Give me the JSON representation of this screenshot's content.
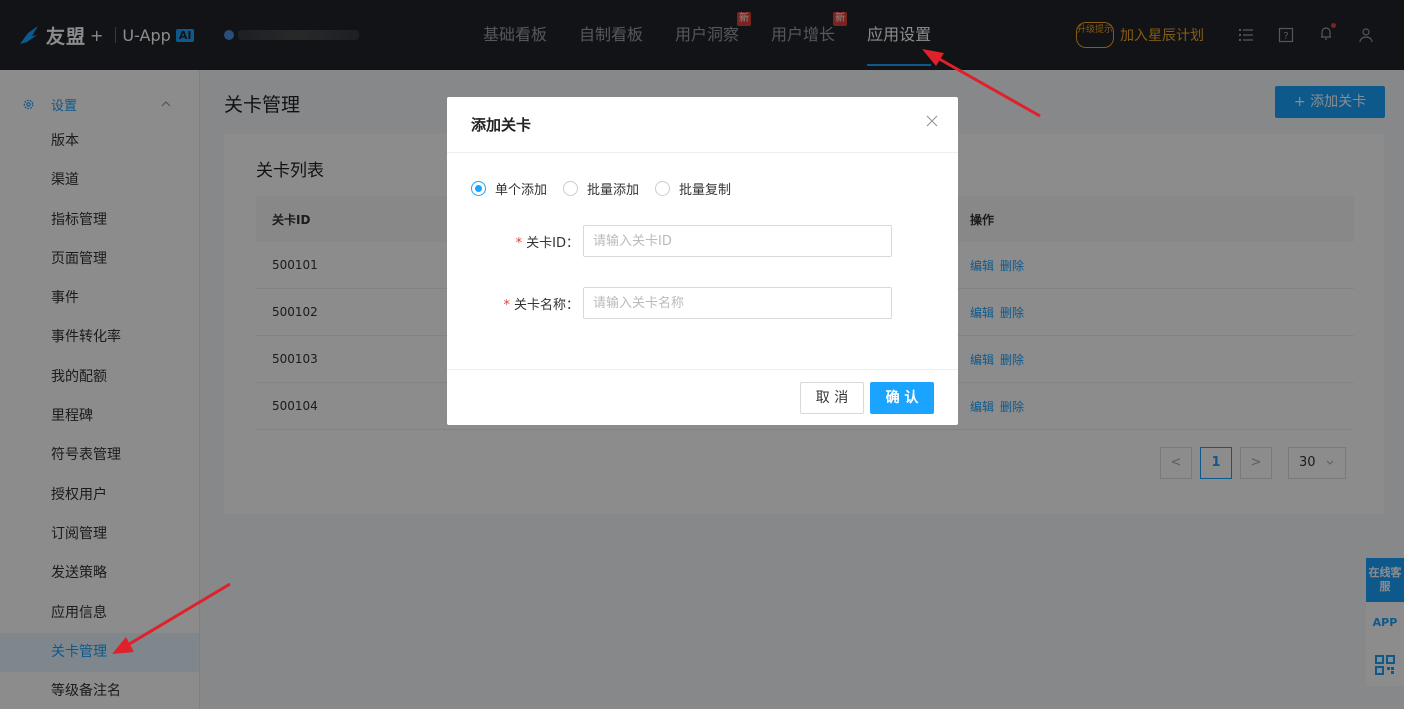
{
  "header": {
    "brand": "友盟",
    "plus": "+",
    "product": "U-App",
    "ai_badge": "AI",
    "nav": [
      {
        "label": "基础看板",
        "badge": ""
      },
      {
        "label": "自制看板",
        "badge": ""
      },
      {
        "label": "用户洞察",
        "badge": "新"
      },
      {
        "label": "用户增长",
        "badge": "新"
      },
      {
        "label": "应用设置",
        "badge": ""
      }
    ],
    "upgrade_hint": "升级提示",
    "join_plan": "加入星辰计划"
  },
  "sidebar": {
    "section": "设置",
    "items": [
      "版本",
      "渠道",
      "指标管理",
      "页面管理",
      "事件",
      "事件转化率",
      "我的配额",
      "里程碑",
      "符号表管理",
      "授权用户",
      "订阅管理",
      "发送策略",
      "应用信息",
      "关卡管理",
      "等级备注名"
    ],
    "active_index": 13
  },
  "main": {
    "page_title": "关卡管理",
    "add_button": "+ 添加关卡",
    "card_title": "关卡列表",
    "table": {
      "headers": [
        "关卡ID",
        "操作"
      ],
      "rows": [
        {
          "id": "500101",
          "edit": "编辑",
          "delete": "删除"
        },
        {
          "id": "500102",
          "edit": "编辑",
          "delete": "删除"
        },
        {
          "id": "500103",
          "edit": "编辑",
          "delete": "删除"
        },
        {
          "id": "500104",
          "edit": "编辑",
          "delete": "删除"
        }
      ]
    },
    "pagination": {
      "prev": "<",
      "current": "1",
      "next": ">",
      "page_size": "30"
    }
  },
  "modal": {
    "title": "添加关卡",
    "close": "×",
    "modes": [
      {
        "label": "单个添加",
        "selected": true
      },
      {
        "label": "批量添加",
        "selected": false
      },
      {
        "label": "批量复制",
        "selected": false
      }
    ],
    "fields": {
      "id": {
        "label": "关卡ID",
        "placeholder": "请输入关卡ID",
        "value": ""
      },
      "name": {
        "label": "关卡名称",
        "placeholder": "请输入关卡名称",
        "value": ""
      }
    },
    "cancel": "取 消",
    "confirm": "确 认"
  },
  "float_service": {
    "online": "在线客服",
    "app": "APP"
  },
  "colors": {
    "accent": "#1aa3ff",
    "topbar": "#1f2329",
    "badge_red": "#e0403a",
    "upgrade_orange": "#f5a623",
    "annotation_arrow": "#e0202a"
  }
}
